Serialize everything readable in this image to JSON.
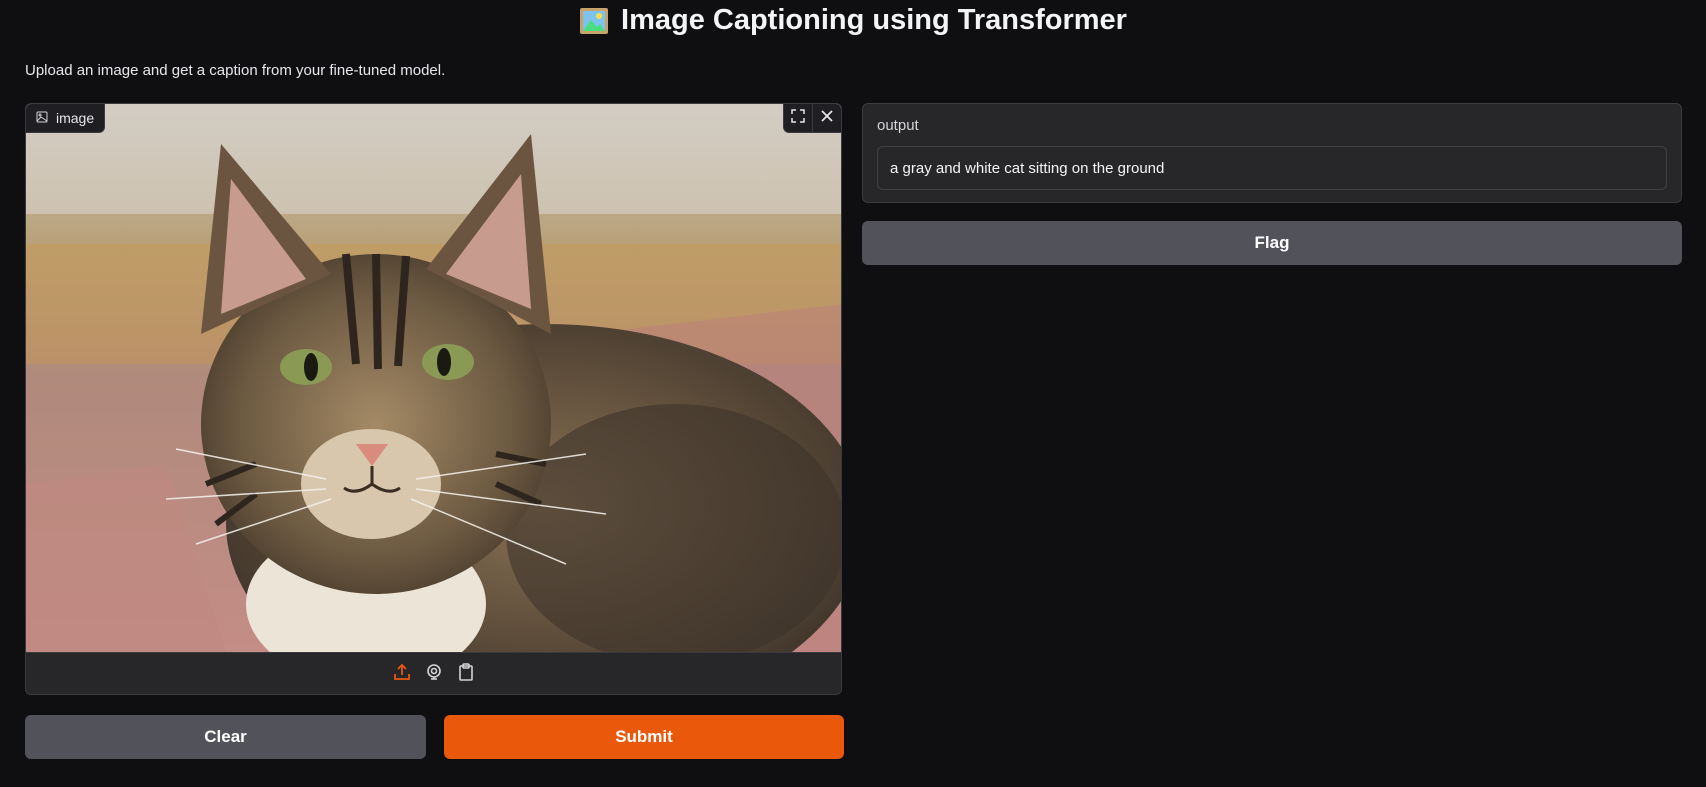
{
  "header": {
    "title_icon": "framed-picture-emoji",
    "title": "Image Captioning using Transformer",
    "description": "Upload an image and get a caption from your fine-tuned model."
  },
  "image_input": {
    "label": "image",
    "label_icon": "image-icon",
    "fullscreen_icon": "fullscreen-icon",
    "close_icon": "close-icon",
    "sources": [
      {
        "name": "upload",
        "icon": "upload-icon",
        "active": true
      },
      {
        "name": "webcam",
        "icon": "webcam-icon",
        "active": false
      },
      {
        "name": "clipboard",
        "icon": "clipboard-icon",
        "active": false
      }
    ]
  },
  "buttons": {
    "clear": "Clear",
    "submit": "Submit",
    "flag": "Flag"
  },
  "output": {
    "label": "output",
    "value": "a gray and white cat sitting on the ground"
  },
  "colors": {
    "accent": "#ea580c",
    "background": "#0f0f11",
    "panel": "#27272a",
    "secondary_button": "#52525b"
  }
}
